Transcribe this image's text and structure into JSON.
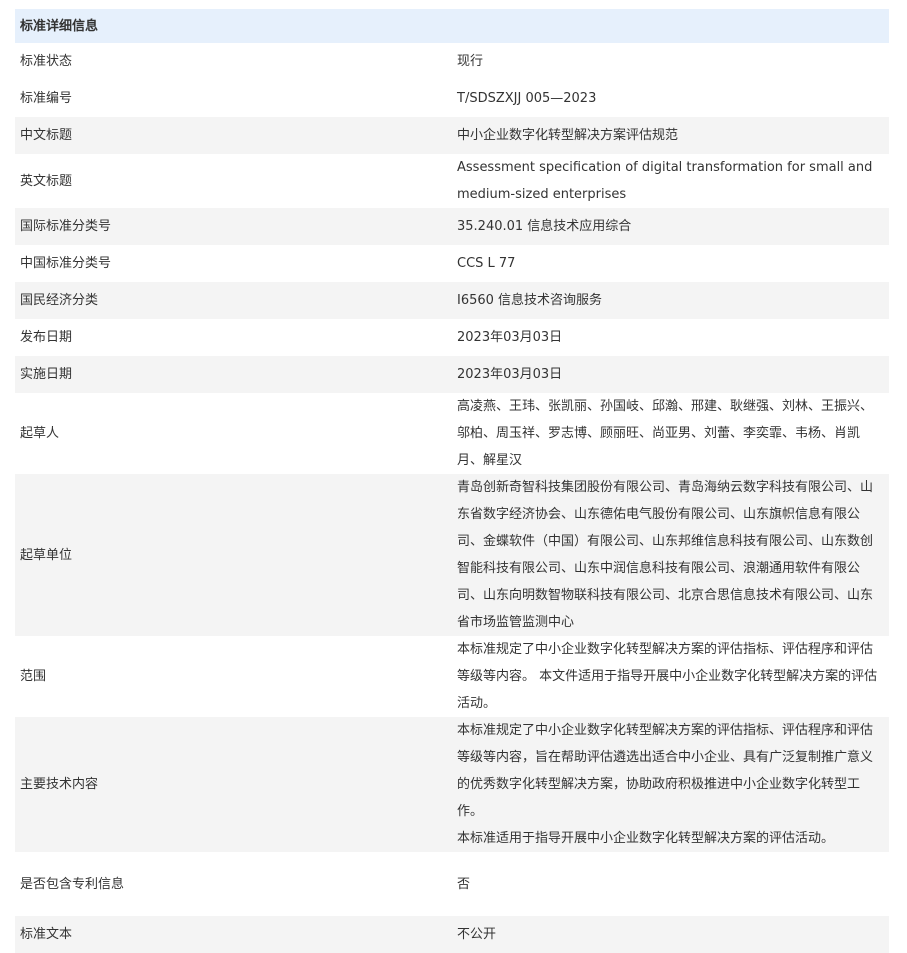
{
  "header": {
    "title": "标准详细信息"
  },
  "rows": [
    {
      "key": "标准状态",
      "value": "现行"
    },
    {
      "key": "标准编号",
      "value": "T/SDSZXJJ 005—2023"
    },
    {
      "key": "中文标题",
      "value": "中小企业数字化转型解决方案评估规范"
    },
    {
      "key": "英文标题",
      "value": "Assessment specification of digital transformation for small and medium-sized enterprises"
    },
    {
      "key": "国际标准分类号",
      "value": "35.240.01 信息技术应用综合"
    },
    {
      "key": "中国标准分类号",
      "value": "CCS L 77"
    },
    {
      "key": "国民经济分类",
      "value": "I6560 信息技术咨询服务"
    },
    {
      "key": "发布日期",
      "value": "2023年03月03日"
    },
    {
      "key": "实施日期",
      "value": "2023年03月03日"
    },
    {
      "key": "起草人",
      "value": "高凌燕、王玮、张凯丽、孙国岐、邱瀚、邢建、耿继强、刘林、王振兴、邬柏、周玉祥、罗志博、顾丽旺、尚亚男、刘蕾、李奕霏、韦杨、肖凯月、解星汉"
    },
    {
      "key": "起草单位",
      "value": "青岛创新奇智科技集团股份有限公司、青岛海纳云数字科技有限公司、山东省数字经济协会、山东德佑电气股份有限公司、山东旗帜信息有限公司、金蝶软件（中国）有限公司、山东邦维信息科技有限公司、山东数创智能科技有限公司、山东中润信息科技有限公司、浪潮通用软件有限公司、山东向明数智物联科技有限公司、北京合思信息技术有限公司、山东省市场监管监测中心"
    },
    {
      "key": "范围",
      "value": "本标准规定了中小企业数字化转型解决方案的评估指标、评估程序和评估等级等内容。 本文件适用于指导开展中小企业数字化转型解决方案的评估活动。"
    },
    {
      "key": "主要技术内容",
      "value": "本标准规定了中小企业数字化转型解决方案的评估指标、评估程序和评估等级等内容，旨在帮助评估遴选出适合中小企业、具有广泛复制推广意义的优秀数字化转型解决方案，协助政府积极推进中小企业数字化转型工作。",
      "value2": "本标准适用于指导开展中小企业数字化转型解决方案的评估活动。"
    },
    {
      "key": "是否包含专利信息",
      "value": "否"
    },
    {
      "key": "标准文本",
      "value": "不公开"
    }
  ]
}
